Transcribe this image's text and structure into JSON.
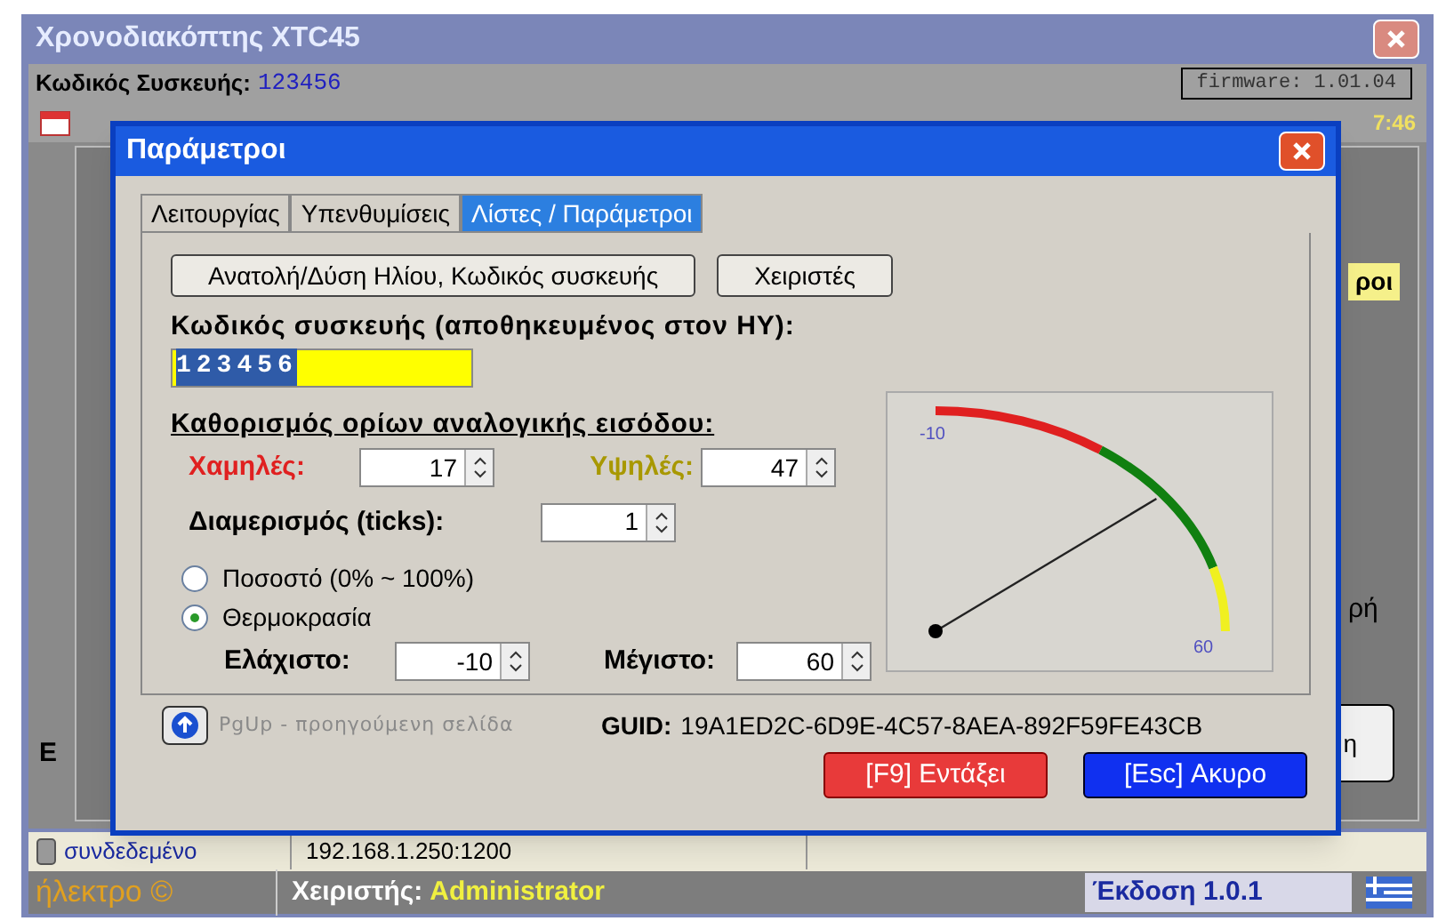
{
  "window": {
    "title": "Χρονοδιακόπτης XTC45"
  },
  "header": {
    "device_code_label": "Κωδικός Συσκευής:",
    "device_code": "123456",
    "firmware": "firmware: 1.01.04",
    "time_fragment": "7:46"
  },
  "background_fragments": [
    {
      "kind": "highlight",
      "text": "ροι"
    },
    {
      "kind": "label",
      "text": "ρή"
    },
    {
      "kind": "left",
      "text": "Ε"
    },
    {
      "kind": "button",
      "text": "η"
    }
  ],
  "dialog": {
    "title": "Παράμετροι",
    "tabs": [
      {
        "label": "Λειτουργίας",
        "selected": false
      },
      {
        "label": "Υπενθυμίσεις",
        "selected": false
      },
      {
        "label": "Λίστες / Παράμετροι",
        "selected": true
      }
    ],
    "top_buttons": [
      "Ανατολή/Δύση Ηλίου, Κωδικός συσκευής",
      "Χειριστές"
    ],
    "device_code_label": "Κωδικός συσκευής (αποθηκευμένος στον ΗΥ):",
    "device_code_value": "123456",
    "analog_title": "Καθορισμός ορίων αναλογικής εισόδου:",
    "low": {
      "label": "Χαμηλές:",
      "value": "17"
    },
    "high": {
      "label": "Υψηλές:",
      "value": "47"
    },
    "ticks": {
      "label": "Διαμερισμός (ticks):",
      "value": "1"
    },
    "modes": [
      {
        "label": "Ποσοστό (0% ~ 100%)",
        "selected": false
      },
      {
        "label": "Θερμοκρασία",
        "selected": true
      }
    ],
    "min": {
      "label": "Ελάχιστο:",
      "value": "-10"
    },
    "max": {
      "label": "Μέγιστο:",
      "value": "60"
    },
    "gauge": {
      "min_label": "-10",
      "max_label": "60"
    },
    "page_hint": "PgUp - προηγούμενη σελίδα",
    "guid_label": "GUID:",
    "guid": "19A1ED2C-6D9E-4C57-8AEA-892F59FE43CB",
    "ok_button": "[F9] Εντάξει",
    "cancel_button": "[Esc] Ακυρο"
  },
  "status_bar": {
    "connection": "συνδεδεμένο",
    "address": "192.168.1.250:1200"
  },
  "footer": {
    "brand": "ήλεκτρο ©",
    "operator_label": "Χειριστής:",
    "operator": "Administrator",
    "version": "Έκδοση 1.0.1"
  }
}
